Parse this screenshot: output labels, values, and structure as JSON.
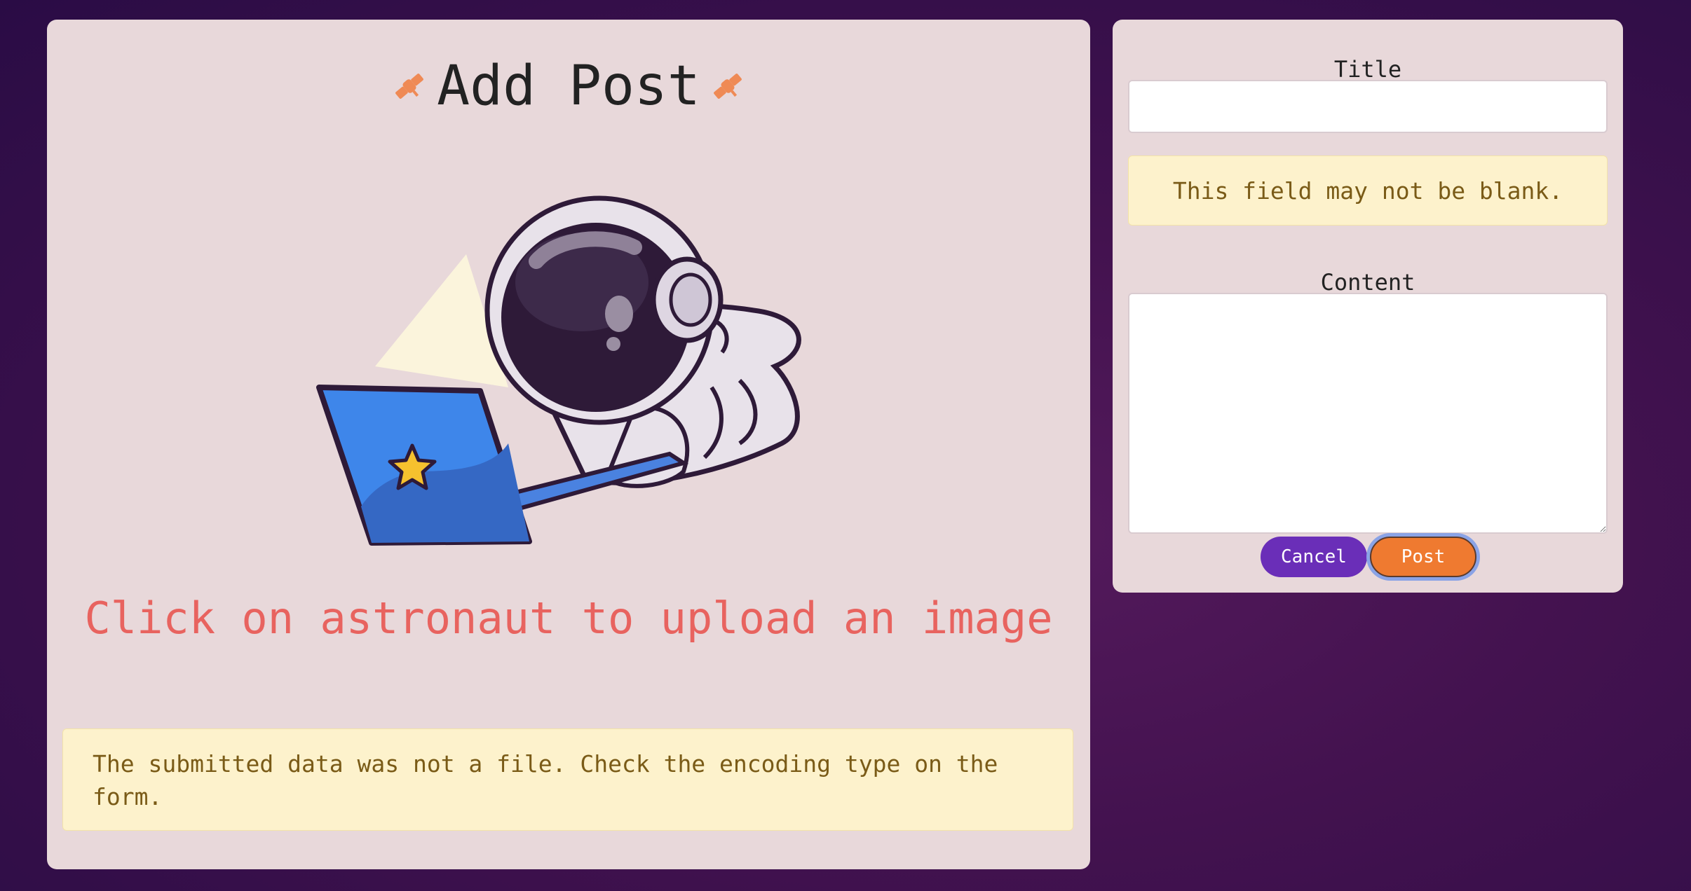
{
  "left_panel": {
    "title": "Add Post",
    "upload_hint": "Click on astronaut to upload an image",
    "file_error": "The submitted data was not a file. Check the encoding type on the form."
  },
  "form": {
    "title_label": "Title",
    "title_value": "",
    "title_error": "This field may not be blank.",
    "content_label": "Content",
    "content_value": "",
    "cancel_label": "Cancel",
    "post_label": "Post"
  },
  "icons": {
    "title_left": "satellite-icon",
    "title_right": "satellite-icon",
    "upload_illustration": "astronaut-laptop"
  },
  "colors": {
    "background": "#3e1250",
    "card": "#e8d8da",
    "hint_text": "#e8635f",
    "warning_bg": "#fdf2cc",
    "warning_text": "#7a5b17",
    "cancel_button": "#6a2eb8",
    "post_button": "#ef7a30",
    "satellite_icon": "#ef8a55"
  }
}
